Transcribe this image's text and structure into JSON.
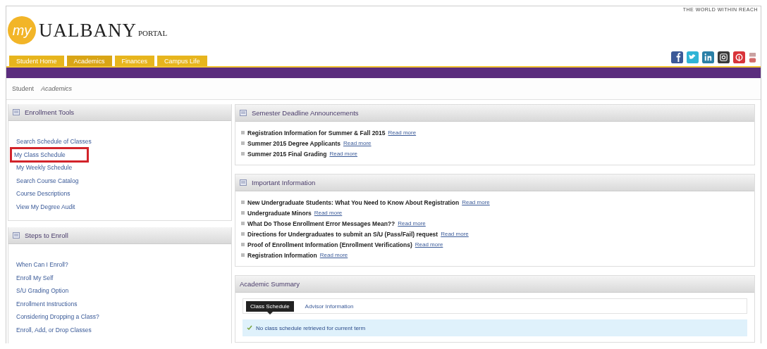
{
  "header": {
    "tagline": "THE WORLD WITHIN REACH",
    "logo_badge": "my",
    "logo_name": "UALBANY",
    "logo_suffix": "PORTAL",
    "tabs": [
      {
        "label": "Student Home",
        "selected": false
      },
      {
        "label": "Academics",
        "selected": true
      },
      {
        "label": "Finances",
        "selected": false
      },
      {
        "label": "Campus Life",
        "selected": false
      }
    ]
  },
  "breadcrumb": [
    "Student",
    "Academics"
  ],
  "sidebar": [
    {
      "title": "Enrollment Tools",
      "items": [
        {
          "label": "Search Schedule of Classes",
          "highlighted": false
        },
        {
          "label": "My Class Schedule",
          "highlighted": true
        },
        {
          "label": "My Weekly Schedule",
          "highlighted": false
        },
        {
          "label": "Search Course Catalog",
          "highlighted": false
        },
        {
          "label": "Course Descriptions",
          "highlighted": false
        },
        {
          "label": "View My Degree Audit",
          "highlighted": false
        }
      ]
    },
    {
      "title": "Steps to Enroll",
      "items": [
        {
          "label": "When Can I Enroll?",
          "highlighted": false
        },
        {
          "label": "Enroll My Self",
          "highlighted": false
        },
        {
          "label": "S/U Grading Option",
          "highlighted": false
        },
        {
          "label": "Enrollment Instructions",
          "highlighted": false
        },
        {
          "label": "Considering Dropping a Class?",
          "highlighted": false
        },
        {
          "label": "Enroll, Add, or Drop Classes",
          "highlighted": false
        }
      ]
    }
  ],
  "announcements": [
    {
      "title": "Semester Deadline Announcements",
      "items": [
        {
          "text": "Registration Information for Summer & Fall 2015",
          "link": "Read more"
        },
        {
          "text": "Summer 2015 Degree Applicants",
          "link": "Read more"
        },
        {
          "text": "Summer 2015 Final Grading",
          "link": "Read more"
        }
      ]
    },
    {
      "title": "Important Information",
      "items": [
        {
          "text": "New Undergraduate Students: What You Need to Know About Registration",
          "link": "Read more"
        },
        {
          "text": "Undergraduate Minors",
          "link": "Read more"
        },
        {
          "text": "What Do Those Enrollment Error Messages Mean??",
          "link": "Read more"
        },
        {
          "text": "Directions for Undergraduates to submit an S/U (Pass/Fail) request",
          "link": "Read more"
        },
        {
          "text": "Proof of Enrollment Information (Enrollment Verifications)",
          "link": "Read more"
        },
        {
          "text": "Registration Information",
          "link": "Read more"
        }
      ]
    }
  ],
  "academic_summary": {
    "title": "Academic Summary",
    "tabs": [
      {
        "label": "Class Schedule",
        "selected": true
      },
      {
        "label": "Advisor Information",
        "selected": false
      }
    ],
    "message": "No class schedule retrieved for current term"
  }
}
